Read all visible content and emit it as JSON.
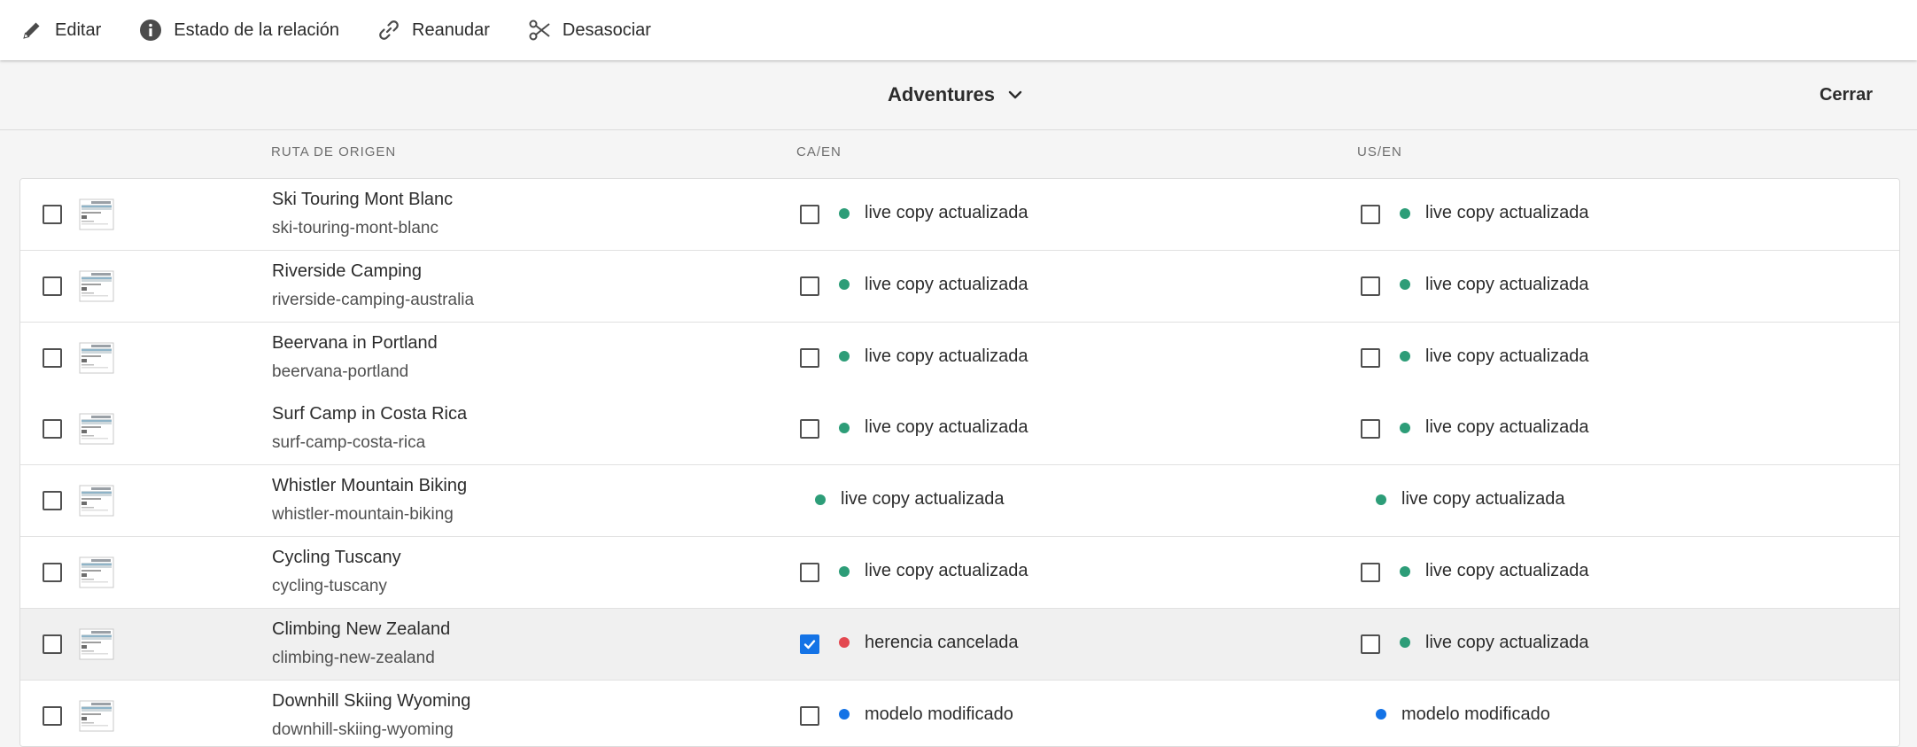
{
  "toolbar": {
    "edit_label": "Editar",
    "relation_status_label": "Estado de la relación",
    "resume_label": "Reanudar",
    "detach_label": "Desasociar"
  },
  "header": {
    "title": "Adventures",
    "close_label": "Cerrar"
  },
  "columns": {
    "source_path": "RUTA DE ORIGEN",
    "ca_en": "CA/EN",
    "us_en": "US/EN"
  },
  "colors": {
    "status_green": "#2d9d78",
    "status_red": "#e34850",
    "status_blue": "#1473e6"
  },
  "rows": [
    {
      "title": "Ski Touring Mont Blanc",
      "path": "ski-touring-mont-blanc",
      "ca": {
        "status": "live copy actualizada",
        "color": "#2d9d78",
        "checkbox": true,
        "checked": false
      },
      "us": {
        "status": "live copy actualizada",
        "color": "#2d9d78",
        "checkbox": true,
        "checked": false
      }
    },
    {
      "title": "Riverside Camping",
      "path": "riverside-camping-australia",
      "ca": {
        "status": "live copy actualizada",
        "color": "#2d9d78",
        "checkbox": true,
        "checked": false
      },
      "us": {
        "status": "live copy actualizada",
        "color": "#2d9d78",
        "checkbox": true,
        "checked": false
      }
    },
    {
      "title": "Beervana in Portland",
      "path": "beervana-portland",
      "ca": {
        "status": "live copy actualizada",
        "color": "#2d9d78",
        "checkbox": true,
        "checked": false
      },
      "us": {
        "status": "live copy actualizada",
        "color": "#2d9d78",
        "checkbox": true,
        "checked": false
      }
    },
    {
      "title": "Surf Camp in Costa Rica",
      "path": "surf-camp-costa-rica",
      "ca": {
        "status": "live copy actualizada",
        "color": "#2d9d78",
        "checkbox": true,
        "checked": false
      },
      "us": {
        "status": "live copy actualizada",
        "color": "#2d9d78",
        "checkbox": true,
        "checked": false
      }
    },
    {
      "title": "Whistler Mountain Biking",
      "path": "whistler-mountain-biking",
      "ca": {
        "status": "live copy actualizada",
        "color": "#2d9d78",
        "checkbox": false,
        "checked": false
      },
      "us": {
        "status": "live copy actualizada",
        "color": "#2d9d78",
        "checkbox": false,
        "checked": false
      }
    },
    {
      "title": "Cycling Tuscany",
      "path": "cycling-tuscany",
      "ca": {
        "status": "live copy actualizada",
        "color": "#2d9d78",
        "checkbox": true,
        "checked": false
      },
      "us": {
        "status": "live copy actualizada",
        "color": "#2d9d78",
        "checkbox": true,
        "checked": false
      }
    },
    {
      "title": "Climbing New Zealand",
      "path": "climbing-new-zealand",
      "selected": true,
      "ca": {
        "status": "herencia cancelada",
        "color": "#e34850",
        "checkbox": true,
        "checked": true
      },
      "us": {
        "status": "live copy actualizada",
        "color": "#2d9d78",
        "checkbox": true,
        "checked": false
      }
    },
    {
      "title": "Downhill Skiing Wyoming",
      "path": "downhill-skiing-wyoming",
      "ca": {
        "status": "modelo modificado",
        "color": "#1473e6",
        "checkbox": true,
        "checked": false
      },
      "us": {
        "status": "modelo modificado",
        "color": "#1473e6",
        "checkbox": false,
        "checked": false
      }
    }
  ]
}
